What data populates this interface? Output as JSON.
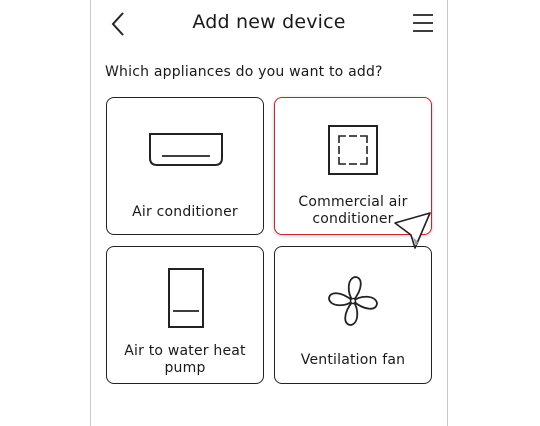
{
  "header": {
    "title": "Add new device",
    "back_icon": "chevron-left-icon",
    "menu_icon": "hamburger-menu-icon"
  },
  "prompt": "Which appliances do you want to add?",
  "selected_color": "#c0262e",
  "appliances": [
    {
      "label": "Air conditioner",
      "icon": "wall-air-conditioner-icon",
      "selected": false
    },
    {
      "label": "Commercial air conditioner",
      "icon": "ceiling-cassette-icon",
      "selected": true
    },
    {
      "label": "Air to water heat pump",
      "icon": "heat-pump-unit-icon",
      "selected": false
    },
    {
      "label": "Ventilation fan",
      "icon": "fan-icon",
      "selected": false
    }
  ]
}
